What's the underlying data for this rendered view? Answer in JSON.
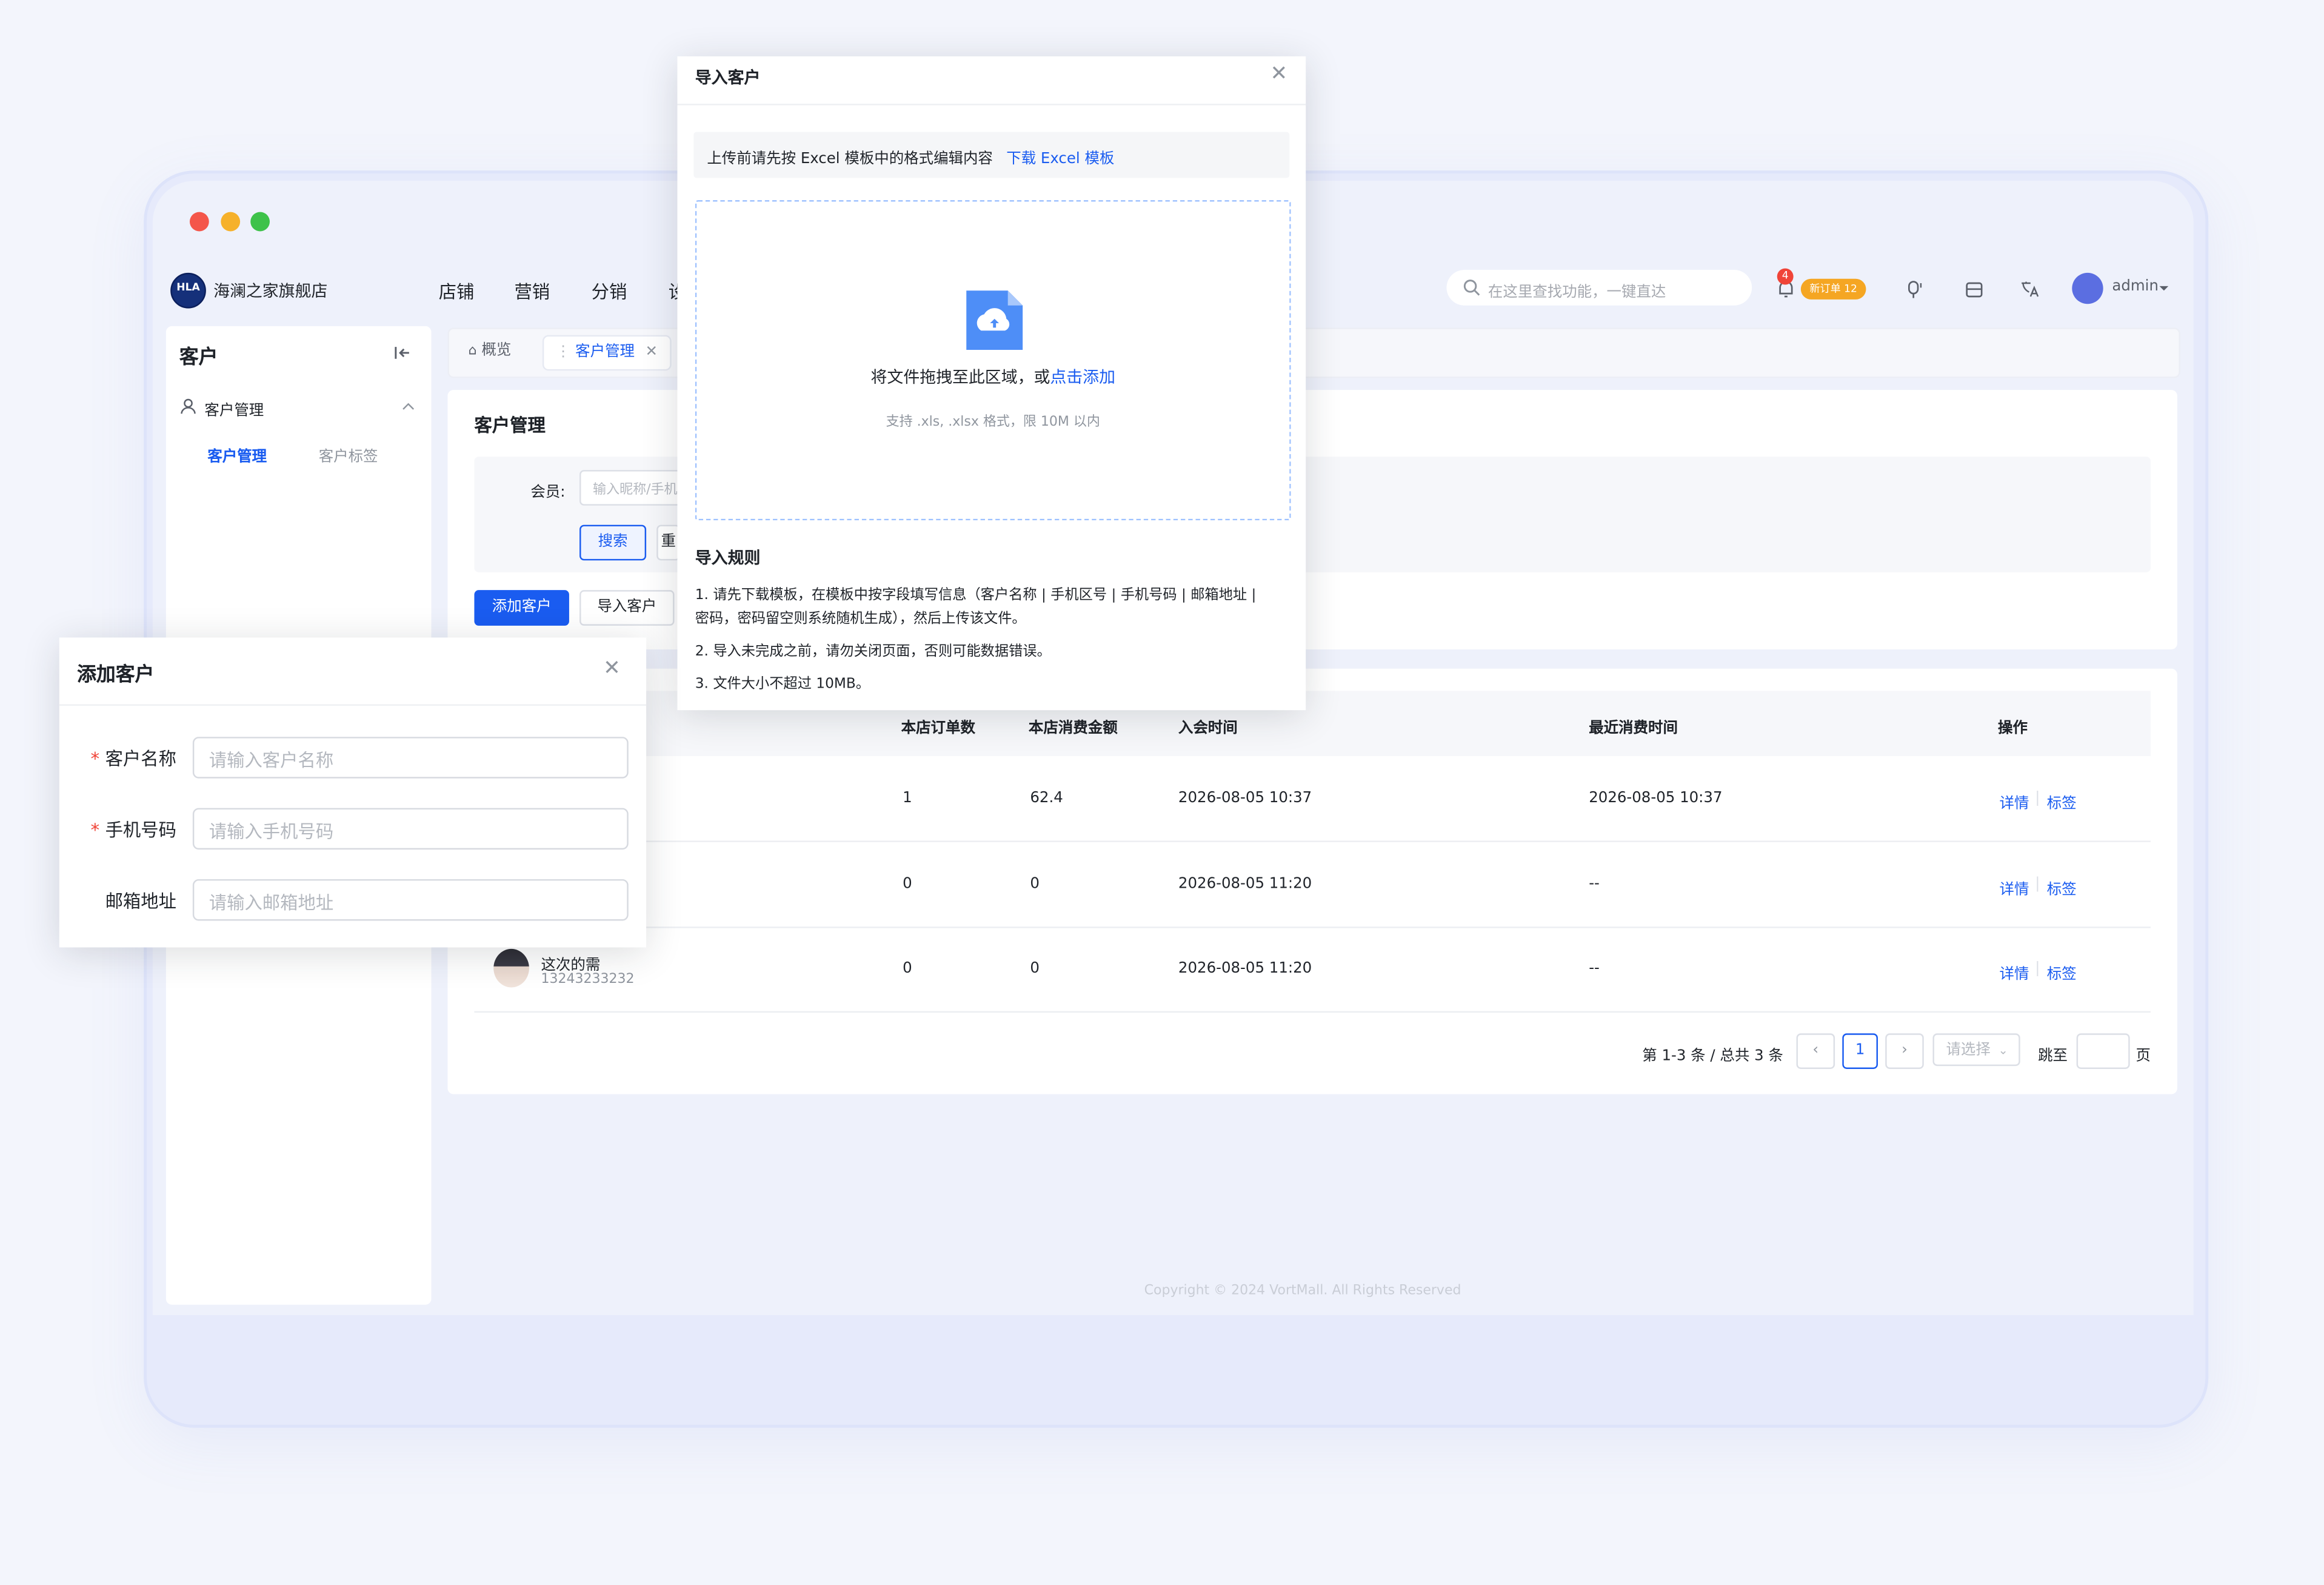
{
  "colors": {
    "accent": "#1a5cf0",
    "danger": "#f04438",
    "warning": "#f5a623",
    "traffic_red": "#f4564a",
    "traffic_yellow": "#f6b12b",
    "traffic_green": "#3ec24a"
  },
  "topbar": {
    "brand": "海澜之家旗舰店",
    "logo_text": "HLA",
    "nav": [
      "店铺",
      "营销",
      "分销",
      "设"
    ],
    "search_placeholder": "在这里查找功能，一键直达",
    "notification_count": "4",
    "order_pill": "新订单 12",
    "user": "admin",
    "icons": [
      "search-icon",
      "bell-icon",
      "headset-icon",
      "store-icon",
      "translate-icon",
      "chevron-down-icon"
    ]
  },
  "sidebar": {
    "title": "客户",
    "group": "客户管理",
    "items": [
      "客户管理",
      "客户标签"
    ]
  },
  "tabs": [
    {
      "label": "概览"
    },
    {
      "label": "客户管理"
    }
  ],
  "page": {
    "title": "客户管理",
    "filter_label": "会员:",
    "filter_placeholder": "输入昵称/手机",
    "search_btn": "搜索",
    "reset_btn": "重",
    "add_btn": "添加客户",
    "import_btn": "导入客户"
  },
  "table": {
    "columns": [
      "本店订单数",
      "本店消费金额",
      "入会时间",
      "最近消费时间",
      "操作"
    ],
    "rows": [
      {
        "name": "",
        "phone": "",
        "orders": "1",
        "amount": "62.4",
        "joined": "2026-08-05 10:37",
        "last": "2026-08-05 10:37"
      },
      {
        "name": "",
        "phone": "",
        "orders": "0",
        "amount": "0",
        "joined": "2026-08-05 11:20",
        "last": "--"
      },
      {
        "name": "这次的需",
        "phone": "13243233232",
        "orders": "0",
        "amount": "0",
        "joined": "2026-08-05 11:20",
        "last": "--"
      }
    ],
    "action_detail": "详情",
    "action_tag": "标签"
  },
  "pagination": {
    "summary": "第 1-3 条 / 总共 3 条",
    "current": "1",
    "size_placeholder": "请选择",
    "jump_label": "跳至",
    "page_unit": "页"
  },
  "copyright": "Copyright © 2024 VortMall. All Rights Reserved",
  "import_modal": {
    "title": "导入客户",
    "hint": "上传前请先按 Excel 模板中的格式编辑内容",
    "download_link": "下载 Excel 模板",
    "drop_text": "将文件拖拽至此区域，或",
    "drop_link": "点击添加",
    "drop_sub": "支持 .xls, .xlsx 格式，限 10M 以内",
    "rules_title": "导入规则",
    "rules": [
      "1. 请先下载模板，在模板中按字段填写信息（客户名称 | 手机区号 | 手机号码 | 邮箱地址 |",
      "密码，密码留空则系统随机生成），然后上传该文件。",
      "2. 导入未完成之前，请勿关闭页面，否则可能数据错误。",
      "3. 文件大小不超过 10MB。"
    ]
  },
  "add_modal": {
    "title": "添加客户",
    "fields": [
      {
        "label": "客户名称",
        "placeholder": "请输入客户名称",
        "required": true
      },
      {
        "label": "手机号码",
        "placeholder": "请输入手机号码",
        "required": true
      },
      {
        "label": "邮箱地址",
        "placeholder": "请输入邮箱地址",
        "required": false
      }
    ],
    "required_mark": "*"
  }
}
